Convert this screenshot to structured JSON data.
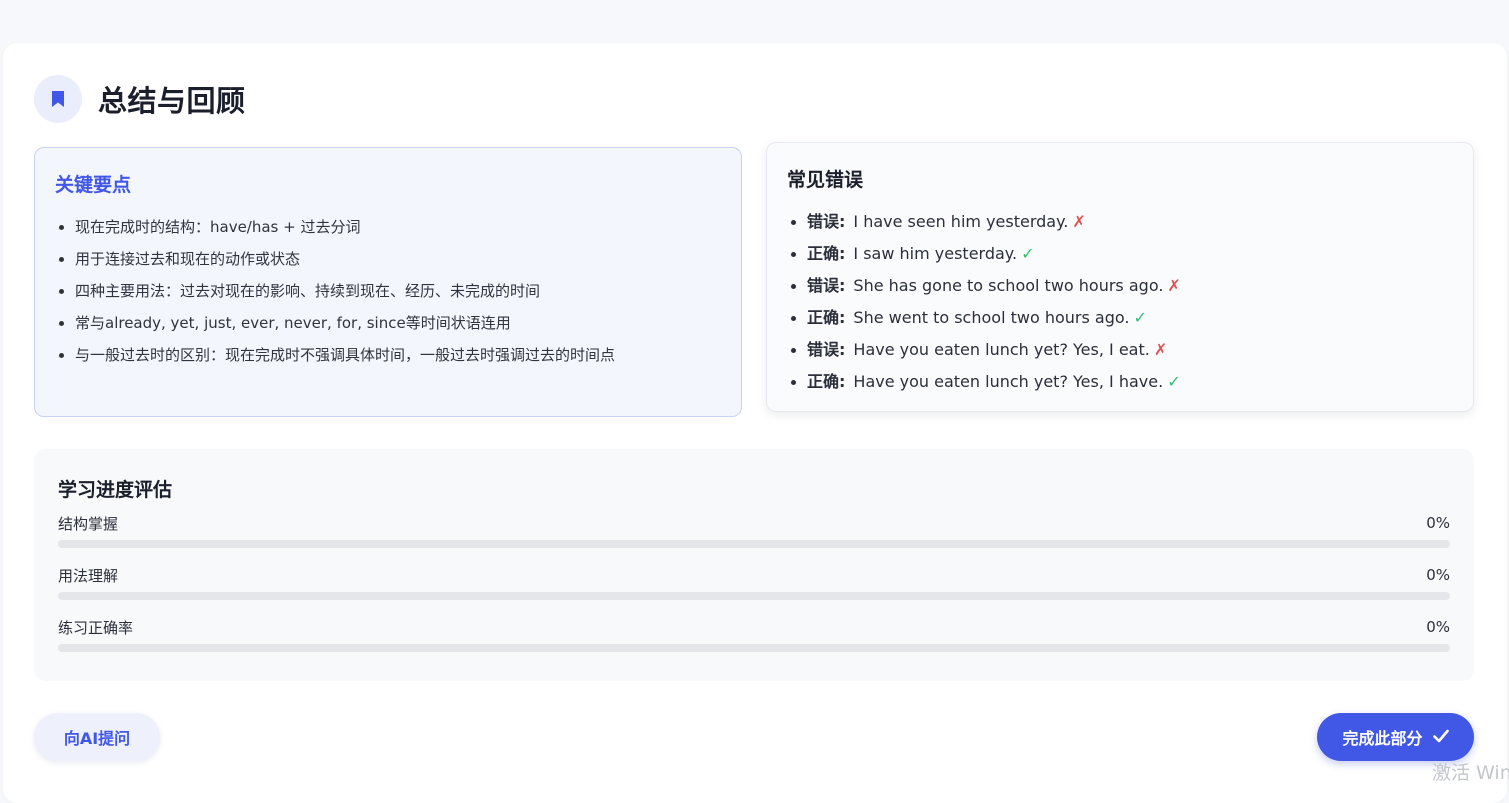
{
  "header": {
    "title": "总结与回顾",
    "icon": "bookmark-icon",
    "icon_color": "#4157e6"
  },
  "key_points": {
    "title": "关键要点",
    "items": [
      "现在完成时的结构：have/has + 过去分词",
      "用于连接过去和现在的动作或状态",
      "四种主要用法：过去对现在的影响、持续到现在、经历、未完成的时间",
      "常与already, yet, just, ever, never, for, since等时间状语连用",
      "与一般过去时的区别：现在完成时不强调具体时间，一般过去时强调过去的时间点"
    ]
  },
  "mistakes": {
    "title": "常见错误",
    "items": [
      {
        "label": "错误:",
        "text": "I have seen him yesterday.",
        "mark": "✗",
        "kind": "wrong"
      },
      {
        "label": "正确:",
        "text": "I saw him yesterday.",
        "mark": "✓",
        "kind": "right"
      },
      {
        "label": "错误:",
        "text": "She has gone to school two hours ago.",
        "mark": "✗",
        "kind": "wrong"
      },
      {
        "label": "正确:",
        "text": "She went to school two hours ago.",
        "mark": "✓",
        "kind": "right"
      },
      {
        "label": "错误:",
        "text": "Have you eaten lunch yet? Yes, I eat.",
        "mark": "✗",
        "kind": "wrong"
      },
      {
        "label": "正确:",
        "text": "Have you eaten lunch yet? Yes, I have.",
        "mark": "✓",
        "kind": "right"
      }
    ]
  },
  "progress": {
    "title": "学习进度评估",
    "items": [
      {
        "label": "结构掌握",
        "value_text": "0%",
        "percent": 0
      },
      {
        "label": "用法理解",
        "value_text": "0%",
        "percent": 0
      },
      {
        "label": "练习正确率",
        "value_text": "0%",
        "percent": 0
      }
    ]
  },
  "actions": {
    "ask_ai_label": "向AI提问",
    "complete_label": "完成此部分",
    "complete_icon": "check-icon"
  },
  "watermark": {
    "text": "激活 Windows"
  },
  "colors": {
    "accent": "#4157e6",
    "wrong": "#e05252",
    "right": "#2fbf71"
  }
}
